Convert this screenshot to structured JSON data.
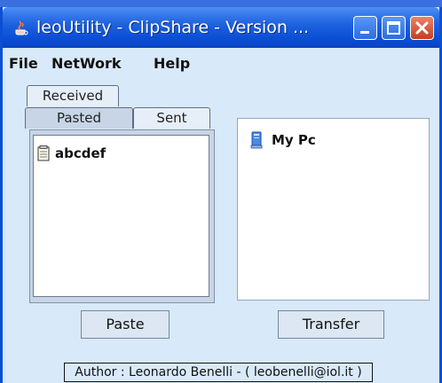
{
  "window": {
    "title": "leoUtility - ClipShare - Version ..."
  },
  "menu": {
    "items": [
      "File",
      "NetWork",
      "Help"
    ]
  },
  "tabs": {
    "received": "Received",
    "pasted": "Pasted",
    "sent": "Sent",
    "selected": "Pasted"
  },
  "clipboard_list": {
    "items": [
      {
        "label": "abcdef",
        "icon": "notepad-icon"
      }
    ]
  },
  "peers": {
    "items": [
      {
        "label": "My Pc",
        "icon": "computer-icon"
      }
    ]
  },
  "buttons": {
    "paste": "Paste",
    "transfer": "Transfer"
  },
  "footer": {
    "author": "Author : Leonardo Benelli - ( leobenelli@iol.it )"
  },
  "colors": {
    "titlebar": "#0a4fd6",
    "window_bg": "#d8e9f9",
    "close_button": "#c4401d"
  }
}
